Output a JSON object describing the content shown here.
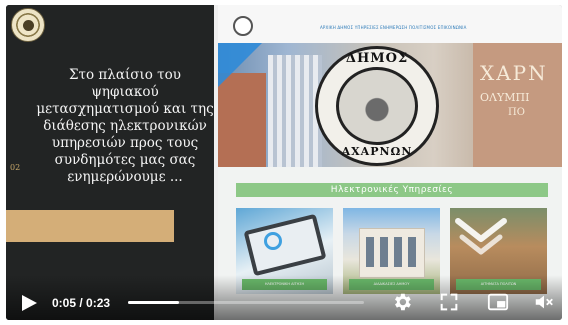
{
  "slide": {
    "text": "Στο πλαίσιο του ψηφιακού μετασχηματισμού και της διάθεσης ηλεκτρονικών υπηρεσιών προς τους συνδημότες μας σας ενημερώνουμε ...",
    "number": "02"
  },
  "site": {
    "nav_text": "ΑΡΧΙΚΗ  ΔΗΜΟΣ  ΥΠΗΡΕΣΙΕΣ  ΕΝΗΜΕΡΩΣΗ  ΠΟΛΙΤΙΣΜΟΣ  ΕΠΙΚΟΙΝΩΝΙΑ",
    "seal_top": "ΔΗΜΟΣ",
    "seal_bottom": "ΑΧΑΡΝΩΝ",
    "hero_title": "ΧΑΡΝ",
    "hero_sub1": "ΟΛΥΜΠΙ",
    "hero_sub2": "ΠΟ",
    "services_heading": "Ηλεκτρονικές Υπηρεσίες",
    "cards": [
      {
        "caption": "ΗΛΕΚΤΡΟΝΙΚΗ ΑΙΤΗΣΗ"
      },
      {
        "caption": "ΔΙΑΔΙΚΑΣΙΕΣ ΔΗΜΟΥ"
      },
      {
        "caption": "ΑΙΤΗΜΑΤΑ ΠΟΛΙΤΩΝ"
      }
    ]
  },
  "player": {
    "time_display": "0:05 / 0:23",
    "progress_fraction": 0.217,
    "icons": [
      "play-icon",
      "gear-icon",
      "fullscreen-icon",
      "pip-icon",
      "volume-icon",
      "chevron-down-icon"
    ],
    "colors": {
      "accent_gold": "#d4ae78",
      "services_green": "#8dc887",
      "background": "#1f2020"
    }
  }
}
